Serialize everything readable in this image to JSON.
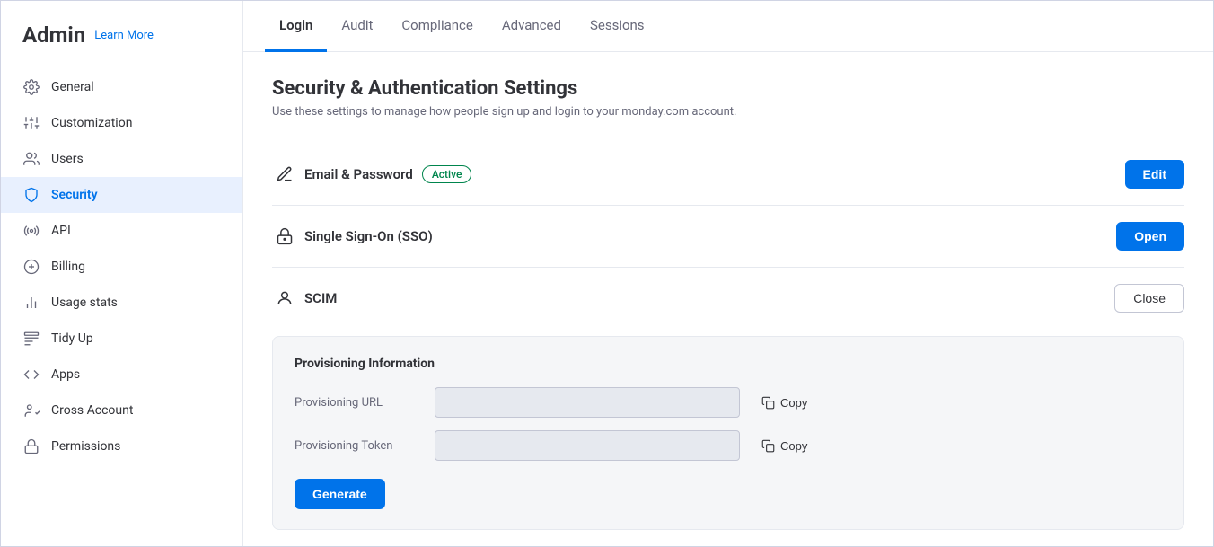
{
  "sidebar": {
    "title": "Admin",
    "learn_more": "Learn More",
    "items": [
      {
        "id": "general",
        "label": "General",
        "icon": "gear"
      },
      {
        "id": "customization",
        "label": "Customization",
        "icon": "sliders"
      },
      {
        "id": "users",
        "label": "Users",
        "icon": "users"
      },
      {
        "id": "security",
        "label": "Security",
        "icon": "shield",
        "active": true
      },
      {
        "id": "api",
        "label": "API",
        "icon": "api"
      },
      {
        "id": "billing",
        "label": "Billing",
        "icon": "dollar"
      },
      {
        "id": "usage-stats",
        "label": "Usage stats",
        "icon": "bar-chart"
      },
      {
        "id": "tidy-up",
        "label": "Tidy Up",
        "icon": "tidy"
      },
      {
        "id": "apps",
        "label": "Apps",
        "icon": "code"
      },
      {
        "id": "cross-account",
        "label": "Cross Account",
        "icon": "cross-account"
      },
      {
        "id": "permissions",
        "label": "Permissions",
        "icon": "lock"
      }
    ]
  },
  "tabs": [
    {
      "id": "login",
      "label": "Login",
      "active": true
    },
    {
      "id": "audit",
      "label": "Audit",
      "active": false
    },
    {
      "id": "compliance",
      "label": "Compliance",
      "active": false
    },
    {
      "id": "advanced",
      "label": "Advanced",
      "active": false
    },
    {
      "id": "sessions",
      "label": "Sessions",
      "active": false
    }
  ],
  "page": {
    "title": "Security & Authentication Settings",
    "subtitle": "Use these settings to manage how people sign up and login to your monday.com account."
  },
  "sections": [
    {
      "id": "email-password",
      "title": "Email & Password",
      "badge": "Active",
      "button_label": "Edit",
      "button_type": "primary"
    },
    {
      "id": "sso",
      "title": "Single Sign-On (SSO)",
      "button_label": "Open",
      "button_type": "primary"
    },
    {
      "id": "scim",
      "title": "SCIM",
      "button_label": "Close",
      "button_type": "secondary",
      "expanded": true
    }
  ],
  "scim": {
    "section_title": "Provisioning Information",
    "fields": [
      {
        "id": "provisioning-url",
        "label": "Provisioning URL",
        "value": ""
      },
      {
        "id": "provisioning-token",
        "label": "Provisioning Token",
        "value": ""
      }
    ],
    "copy_label": "Copy",
    "generate_label": "Generate"
  }
}
